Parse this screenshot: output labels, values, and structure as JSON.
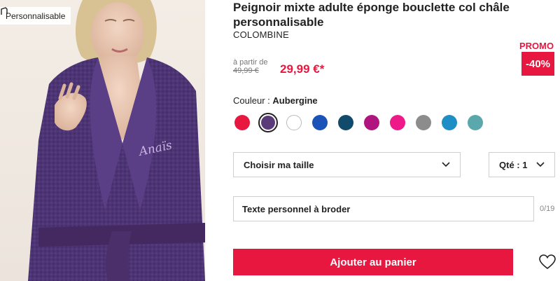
{
  "badge": {
    "label": "Personnalisable",
    "icon": "pen-icon"
  },
  "product": {
    "title": "Peignoir mixte adulte éponge bouclette col châle personnalisable",
    "brand": "COLOMBINE",
    "from_label": "à partir de",
    "old_price": "49,99 €",
    "price": "29,99 €*",
    "promo_label": "PROMO",
    "promo_discount": "-40%",
    "embroidery_text": "Anaïs"
  },
  "color": {
    "label": "Couleur : ",
    "selected_name": "Aubergine",
    "swatches": [
      "#e8173f",
      "#5b3a7a",
      "#ffffff",
      "#1a53b8",
      "#124a6b",
      "#b0157f",
      "#ee1a8a",
      "#8c8c8c",
      "#1e8ec4",
      "#5aa8ac"
    ],
    "selected_index": 1
  },
  "size_select": {
    "label": "Choisir ma taille"
  },
  "qty_select": {
    "label": "Qté : 1"
  },
  "text_field": {
    "placeholder": "Texte personnel à broder",
    "counter": "0/19"
  },
  "cart_button": {
    "label": "Ajouter au panier"
  },
  "colors": {
    "accent": "#e8173f",
    "robe": "#4d3474"
  }
}
